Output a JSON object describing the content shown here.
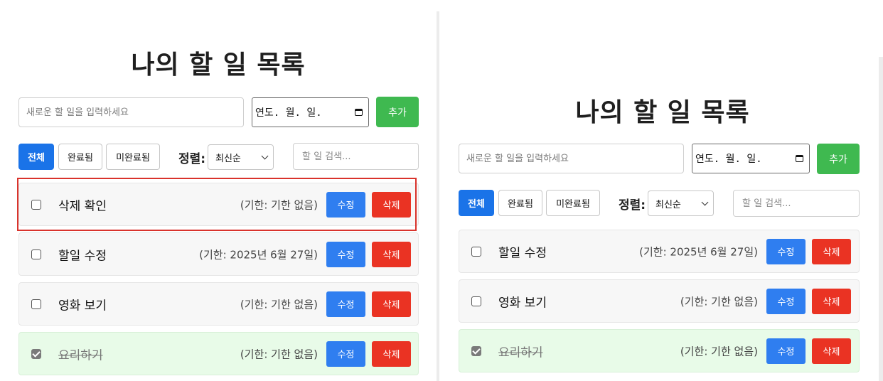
{
  "left": {
    "title": "나의 할 일 목록",
    "task_input_placeholder": "새로운 할 일을 입력하세요",
    "date_value": "연도. 월. 일.",
    "add_label": "추가",
    "filters": [
      "전체",
      "완료됨",
      "미완료됨"
    ],
    "sort_label": "정렬:",
    "sort_value": "최신순",
    "search_placeholder": "할 일 검색...",
    "tasks": [
      {
        "text": "삭제 확인",
        "deadline": "(기한: 기한 없음)",
        "edit": "수정",
        "delete": "삭제",
        "done": false
      },
      {
        "text": "할일 수정",
        "deadline": "(기한: 2025년 6월 27일)",
        "edit": "수정",
        "delete": "삭제",
        "done": false
      },
      {
        "text": "영화 보기",
        "deadline": "(기한: 기한 없음)",
        "edit": "수정",
        "delete": "삭제",
        "done": false
      },
      {
        "text": "요리하기",
        "deadline": "(기한: 기한 없음)",
        "edit": "수정",
        "delete": "삭제",
        "done": true
      }
    ]
  },
  "right": {
    "title": "나의 할 일 목록",
    "task_input_placeholder": "새로운 할 일을 입력하세요",
    "date_value": "연도. 월. 일.",
    "add_label": "추가",
    "filters": [
      "전체",
      "완료됨",
      "미완료됨"
    ],
    "sort_label": "정렬:",
    "sort_value": "최신순",
    "search_placeholder": "할 일 검색...",
    "tasks": [
      {
        "text": "할일 수정",
        "deadline": "(기한: 2025년 6월 27일)",
        "edit": "수정",
        "delete": "삭제",
        "done": false
      },
      {
        "text": "영화 보기",
        "deadline": "(기한: 기한 없음)",
        "edit": "수정",
        "delete": "삭제",
        "done": false
      },
      {
        "text": "요리하기",
        "deadline": "(기한: 기한 없음)",
        "edit": "수정",
        "delete": "삭제",
        "done": true
      }
    ]
  },
  "colors": {
    "add": "#3fb950",
    "active_filter": "#1a73e8",
    "edit": "#2f7ef0",
    "delete": "#ea3323",
    "done_row": "#e8fbe8",
    "highlight": "#d9332c"
  }
}
